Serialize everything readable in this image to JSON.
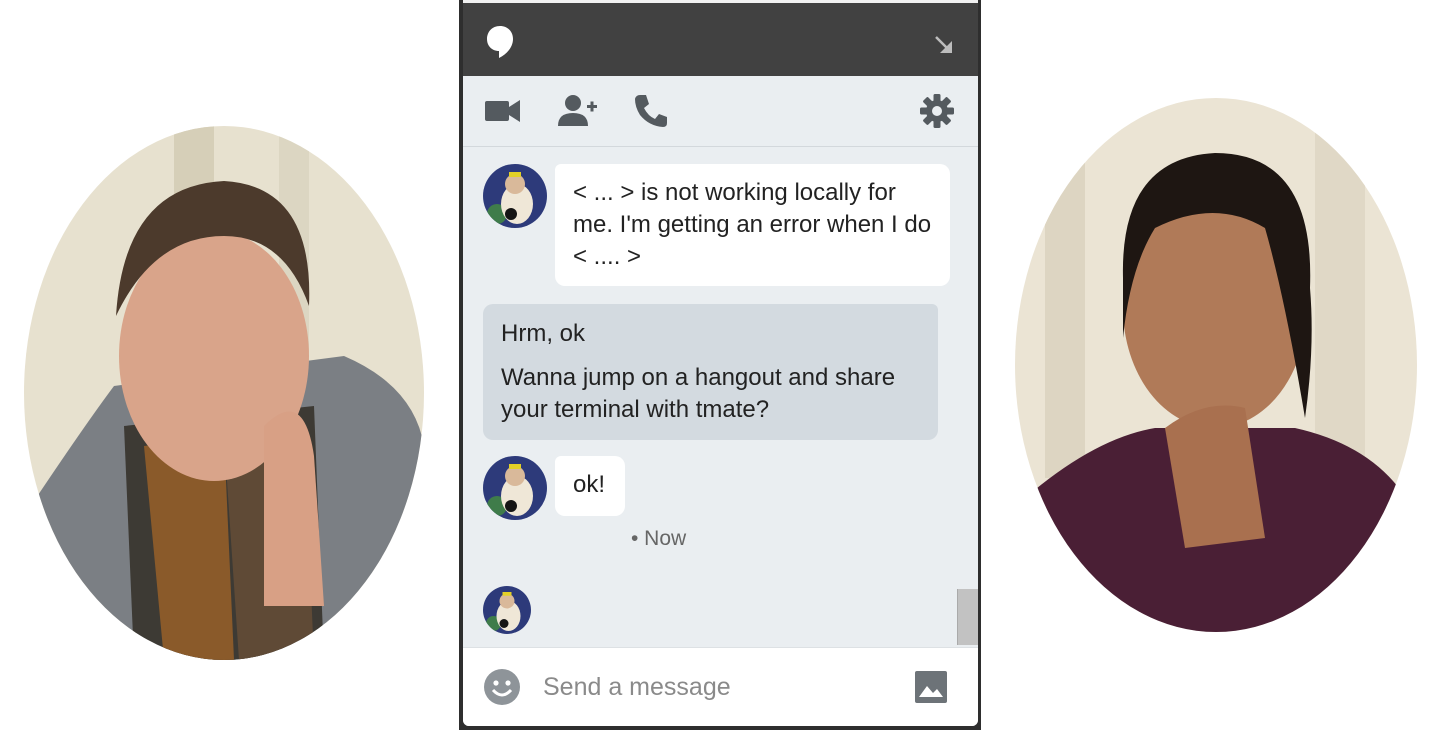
{
  "window": {
    "title_bar_color": "#414141",
    "background": "#eaeef1"
  },
  "toolbar": {
    "icons": [
      "video-icon",
      "add-person-icon",
      "phone-icon",
      "settings-icon"
    ]
  },
  "messages": [
    {
      "direction": "incoming",
      "lines": [
        "< ... > is not working locally for me. I'm getting an error when I do < .... >"
      ]
    },
    {
      "direction": "outgoing",
      "lines": [
        "Hrm, ok",
        "Wanna jump on a hangout and share your terminal with tmate?"
      ]
    },
    {
      "direction": "incoming",
      "lines": [
        "ok!"
      ]
    }
  ],
  "timestamp": "• Now",
  "composer": {
    "placeholder": "Send a message"
  }
}
